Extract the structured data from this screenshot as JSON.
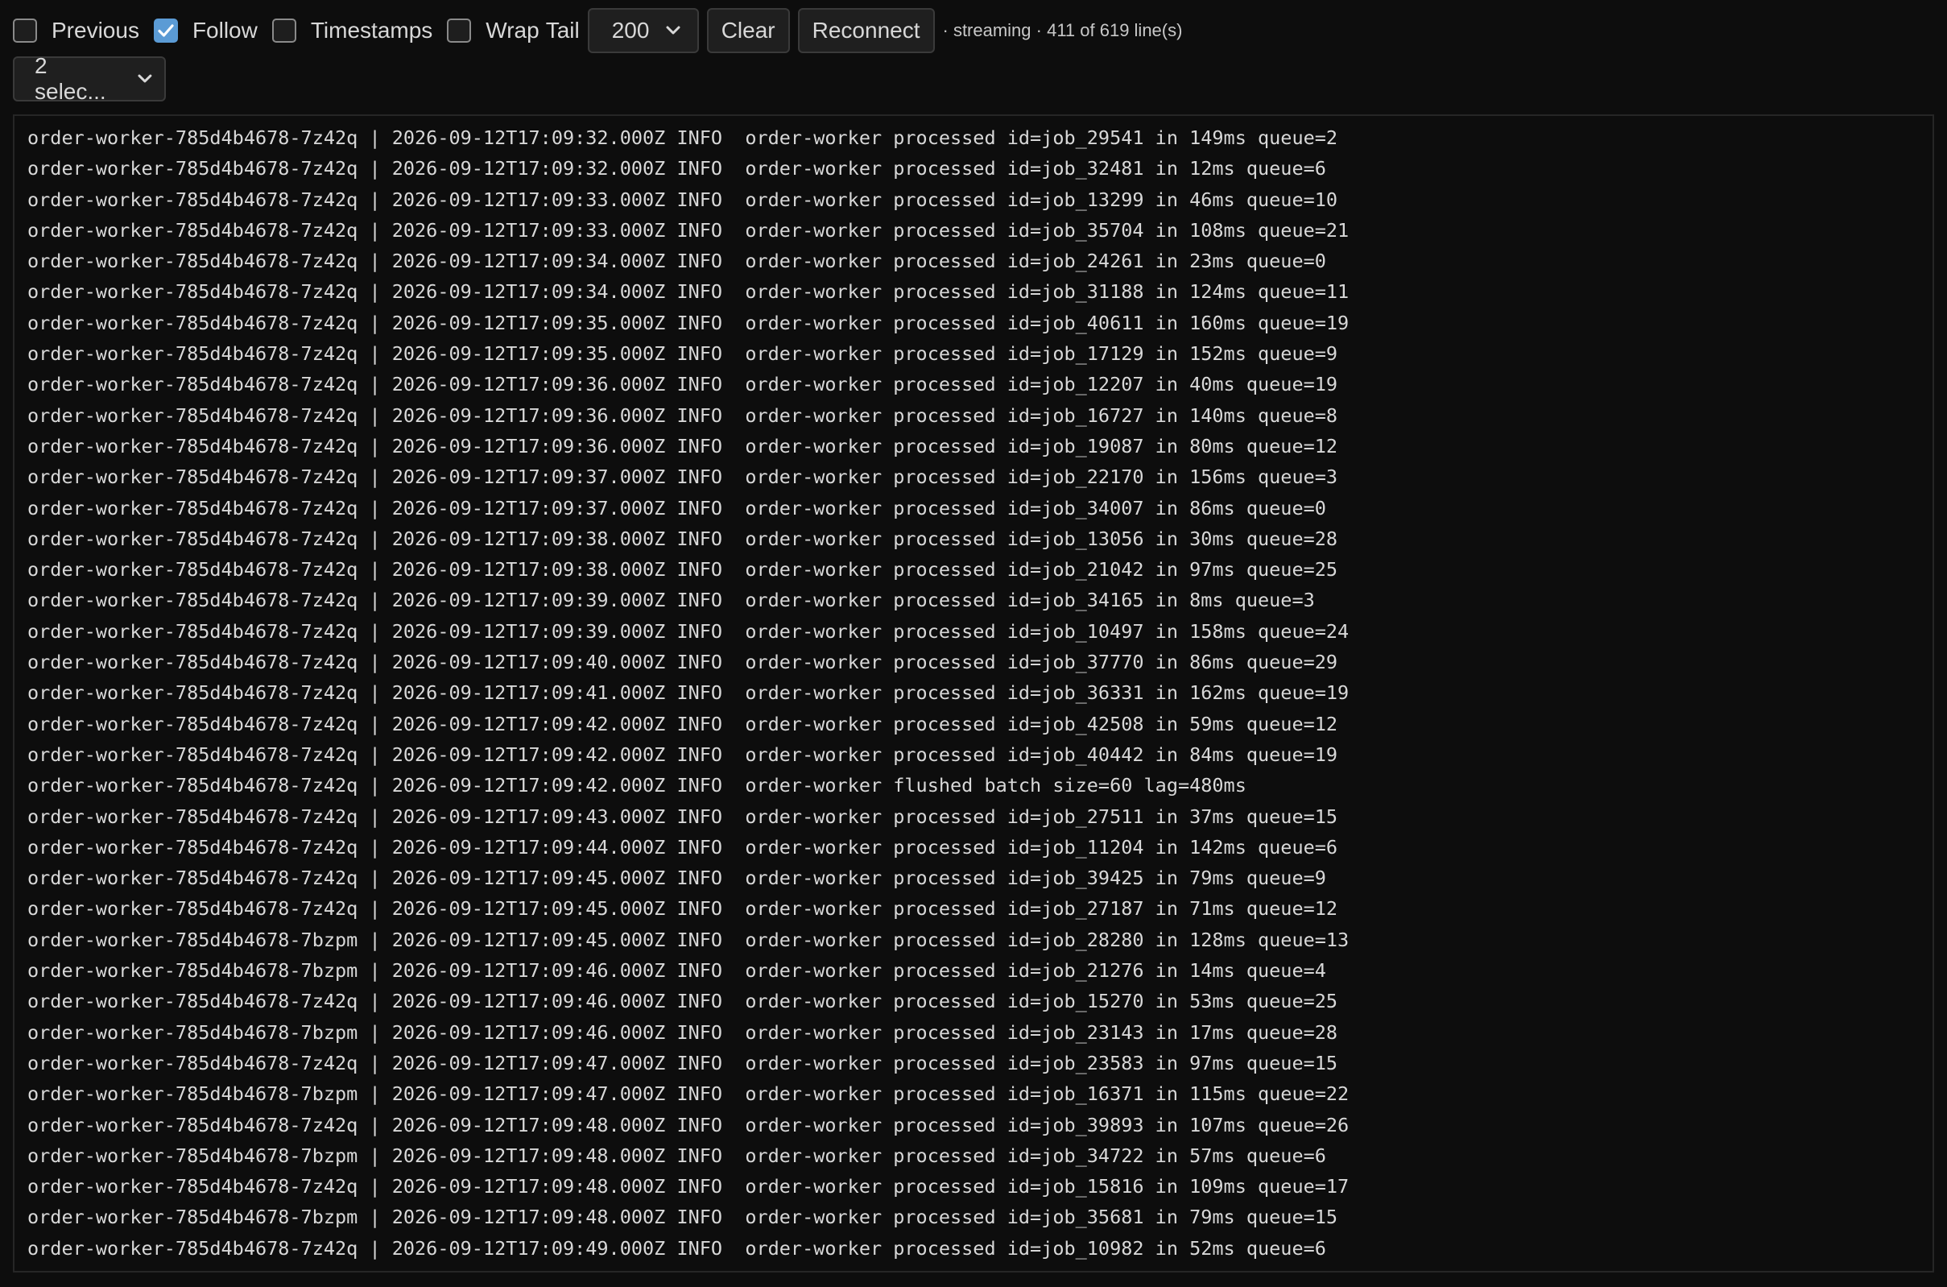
{
  "toolbar": {
    "previous": {
      "label": "Previous",
      "checked": false
    },
    "follow": {
      "label": "Follow",
      "checked": true
    },
    "timestamps": {
      "label": "Timestamps",
      "checked": false
    },
    "wrap": {
      "label": "Wrap",
      "checked": false
    },
    "tail_label": "Tail",
    "tail_value": "200",
    "clear_label": "Clear",
    "reconnect_label": "Reconnect",
    "status": "· streaming · 411 of 619 line(s)"
  },
  "container_select": {
    "value": "2 selec..."
  },
  "log": {
    "lines": [
      "order-worker-785d4b4678-7z42q | 2026-09-12T17:09:32.000Z INFO  order-worker processed id=job_29541 in 149ms queue=2",
      "order-worker-785d4b4678-7z42q | 2026-09-12T17:09:32.000Z INFO  order-worker processed id=job_32481 in 12ms queue=6",
      "order-worker-785d4b4678-7z42q | 2026-09-12T17:09:33.000Z INFO  order-worker processed id=job_13299 in 46ms queue=10",
      "order-worker-785d4b4678-7z42q | 2026-09-12T17:09:33.000Z INFO  order-worker processed id=job_35704 in 108ms queue=21",
      "order-worker-785d4b4678-7z42q | 2026-09-12T17:09:34.000Z INFO  order-worker processed id=job_24261 in 23ms queue=0",
      "order-worker-785d4b4678-7z42q | 2026-09-12T17:09:34.000Z INFO  order-worker processed id=job_31188 in 124ms queue=11",
      "order-worker-785d4b4678-7z42q | 2026-09-12T17:09:35.000Z INFO  order-worker processed id=job_40611 in 160ms queue=19",
      "order-worker-785d4b4678-7z42q | 2026-09-12T17:09:35.000Z INFO  order-worker processed id=job_17129 in 152ms queue=9",
      "order-worker-785d4b4678-7z42q | 2026-09-12T17:09:36.000Z INFO  order-worker processed id=job_12207 in 40ms queue=19",
      "order-worker-785d4b4678-7z42q | 2026-09-12T17:09:36.000Z INFO  order-worker processed id=job_16727 in 140ms queue=8",
      "order-worker-785d4b4678-7z42q | 2026-09-12T17:09:36.000Z INFO  order-worker processed id=job_19087 in 80ms queue=12",
      "order-worker-785d4b4678-7z42q | 2026-09-12T17:09:37.000Z INFO  order-worker processed id=job_22170 in 156ms queue=3",
      "order-worker-785d4b4678-7z42q | 2026-09-12T17:09:37.000Z INFO  order-worker processed id=job_34007 in 86ms queue=0",
      "order-worker-785d4b4678-7z42q | 2026-09-12T17:09:38.000Z INFO  order-worker processed id=job_13056 in 30ms queue=28",
      "order-worker-785d4b4678-7z42q | 2026-09-12T17:09:38.000Z INFO  order-worker processed id=job_21042 in 97ms queue=25",
      "order-worker-785d4b4678-7z42q | 2026-09-12T17:09:39.000Z INFO  order-worker processed id=job_34165 in 8ms queue=3",
      "order-worker-785d4b4678-7z42q | 2026-09-12T17:09:39.000Z INFO  order-worker processed id=job_10497 in 158ms queue=24",
      "order-worker-785d4b4678-7z42q | 2026-09-12T17:09:40.000Z INFO  order-worker processed id=job_37770 in 86ms queue=29",
      "order-worker-785d4b4678-7z42q | 2026-09-12T17:09:41.000Z INFO  order-worker processed id=job_36331 in 162ms queue=19",
      "order-worker-785d4b4678-7z42q | 2026-09-12T17:09:42.000Z INFO  order-worker processed id=job_42508 in 59ms queue=12",
      "order-worker-785d4b4678-7z42q | 2026-09-12T17:09:42.000Z INFO  order-worker processed id=job_40442 in 84ms queue=19",
      "order-worker-785d4b4678-7z42q | 2026-09-12T17:09:42.000Z INFO  order-worker flushed batch size=60 lag=480ms",
      "order-worker-785d4b4678-7z42q | 2026-09-12T17:09:43.000Z INFO  order-worker processed id=job_27511 in 37ms queue=15",
      "order-worker-785d4b4678-7z42q | 2026-09-12T17:09:44.000Z INFO  order-worker processed id=job_11204 in 142ms queue=6",
      "order-worker-785d4b4678-7z42q | 2026-09-12T17:09:45.000Z INFO  order-worker processed id=job_39425 in 79ms queue=9",
      "order-worker-785d4b4678-7z42q | 2026-09-12T17:09:45.000Z INFO  order-worker processed id=job_27187 in 71ms queue=12",
      "order-worker-785d4b4678-7bzpm | 2026-09-12T17:09:45.000Z INFO  order-worker processed id=job_28280 in 128ms queue=13",
      "order-worker-785d4b4678-7bzpm | 2026-09-12T17:09:46.000Z INFO  order-worker processed id=job_21276 in 14ms queue=4",
      "order-worker-785d4b4678-7z42q | 2026-09-12T17:09:46.000Z INFO  order-worker processed id=job_15270 in 53ms queue=25",
      "order-worker-785d4b4678-7bzpm | 2026-09-12T17:09:46.000Z INFO  order-worker processed id=job_23143 in 17ms queue=28",
      "order-worker-785d4b4678-7z42q | 2026-09-12T17:09:47.000Z INFO  order-worker processed id=job_23583 in 97ms queue=15",
      "order-worker-785d4b4678-7bzpm | 2026-09-12T17:09:47.000Z INFO  order-worker processed id=job_16371 in 115ms queue=22",
      "order-worker-785d4b4678-7z42q | 2026-09-12T17:09:48.000Z INFO  order-worker processed id=job_39893 in 107ms queue=26",
      "order-worker-785d4b4678-7bzpm | 2026-09-12T17:09:48.000Z INFO  order-worker processed id=job_34722 in 57ms queue=6",
      "order-worker-785d4b4678-7z42q | 2026-09-12T17:09:48.000Z INFO  order-worker processed id=job_15816 in 109ms queue=17",
      "order-worker-785d4b4678-7bzpm | 2026-09-12T17:09:48.000Z INFO  order-worker processed id=job_35681 in 79ms queue=15",
      "order-worker-785d4b4678-7z42q | 2026-09-12T17:09:49.000Z INFO  order-worker processed id=job_10982 in 52ms queue=6"
    ]
  }
}
